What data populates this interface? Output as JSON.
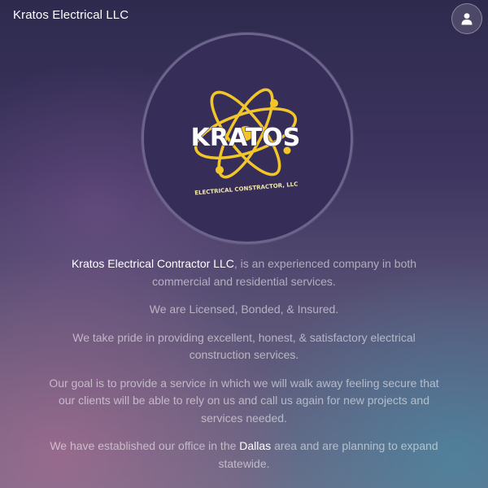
{
  "header": {
    "brand": "Kratos Electrical LLC",
    "user_icon": "user-icon"
  },
  "logo": {
    "wordmark": "KRATOS",
    "tagline": "ELECTRICAL CONSTRACTOR, LLC",
    "icon": "atom-icon",
    "colors": {
      "background": "#362e58",
      "orbit": "#f2c62a",
      "text": "#ffffff"
    }
  },
  "about": {
    "p1_highlight": "Kratos Electrical Contractor LLC",
    "p1_rest": ", is an experienced company in both commercial and residential services.",
    "p2": "We are Licensed, Bonded, & Insured.",
    "p3": "We take pride in providing excellent, honest, & satisfactory electrical construction services.",
    "p4": "Our goal is to provide a service in which we will walk away feeling secure that our clients will be able to rely on us and call us again for new projects and services needed.",
    "p5_before": "We have established our office in the ",
    "p5_highlight": "Dallas",
    "p5_after": " area and are planning to expand statewide."
  },
  "colors": {
    "text_muted": "rgba(255,255,255,0.55)",
    "text_highlight": "#ffffff"
  }
}
